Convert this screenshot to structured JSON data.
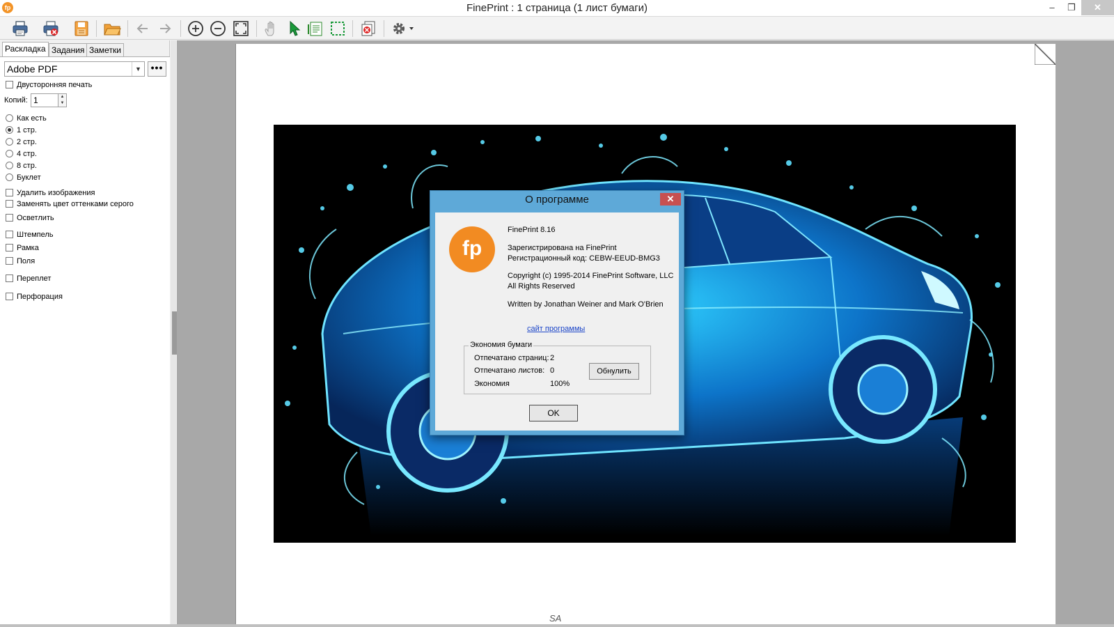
{
  "window": {
    "title": "FinePrint : 1 страница (1 лист бумаги)",
    "app_icon_text": "fp",
    "minimize": "–",
    "maximize": "❐",
    "close": "✕"
  },
  "toolbar": {
    "icons": [
      "print-icon",
      "print-delete-icon",
      "save-icon",
      "open-folder-icon",
      "back-arrow-icon",
      "forward-arrow-icon",
      "zoom-in-icon",
      "zoom-out-icon",
      "fit-page-icon",
      "hand-icon",
      "pointer-icon",
      "text-select-icon",
      "select-area-icon",
      "delete-page-icon",
      "settings-gear-icon"
    ]
  },
  "left_panel": {
    "tabs": [
      {
        "label": "Раскладка",
        "active": true
      },
      {
        "label": "Задания",
        "active": false
      },
      {
        "label": "Заметки",
        "active": false
      }
    ],
    "printer": {
      "value": "Adobe PDF",
      "more_label": "•••"
    },
    "duplex_label": "Двусторонняя печать",
    "copies": {
      "label": "Копий:",
      "value": "1"
    },
    "layout_options": [
      {
        "label": "Как есть",
        "selected": false
      },
      {
        "label": "1 стр.",
        "selected": true
      },
      {
        "label": "2 стр.",
        "selected": false
      },
      {
        "label": "4 стр.",
        "selected": false
      },
      {
        "label": "8 стр.",
        "selected": false
      },
      {
        "label": "Буклет",
        "selected": false
      }
    ],
    "checkboxes": [
      "Удалить изображения",
      "Заменять цвет оттенками серого",
      "Осветлить",
      "Штемпель",
      "Рамка",
      "Поля",
      "Переплет",
      "Перфорация"
    ]
  },
  "preview": {
    "bottom_mark": "SA"
  },
  "about_dialog": {
    "title": "О программе",
    "logo_text": "fp",
    "product": "FinePrint 8.16",
    "registered": "Зарегистрирована на FinePrint",
    "reg_code": "Регистрационный код: CEBW-EEUD-BMG3",
    "copyright": "Copyright (c) 1995-2014 FinePrint Software, LLC",
    "rights": "All Rights Reserved",
    "written_by": "Written by Jonathan Weiner and Mark O'Brien",
    "site_link": "сайт программы",
    "savings": {
      "legend": "Экономия бумаги",
      "rows": [
        {
          "label": "Отпечатано страниц:",
          "value": "2"
        },
        {
          "label": "Отпечатано листов:",
          "value": "0"
        },
        {
          "label": "Экономия",
          "value": "100%"
        }
      ],
      "reset_label": "Обнулить"
    },
    "ok_label": "OK"
  },
  "colors": {
    "accent_orange": "#f28b22",
    "dialog_frame": "#5ea9d8",
    "car_cyan": "#1fb5ff"
  }
}
